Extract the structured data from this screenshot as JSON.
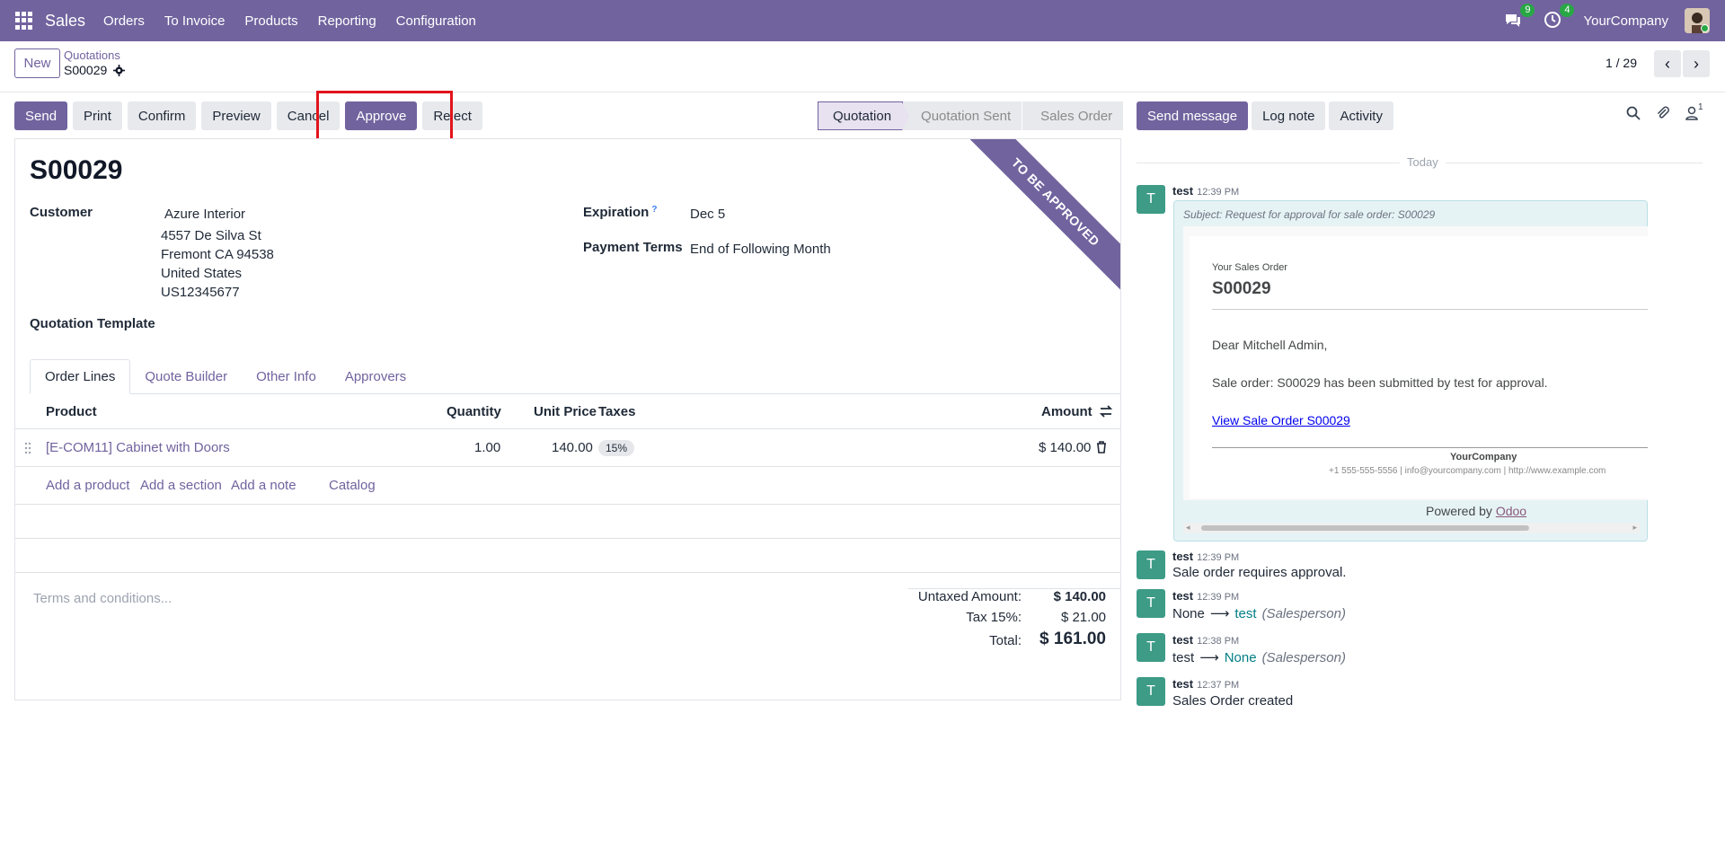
{
  "nav": {
    "app": "Sales",
    "items": [
      "Orders",
      "To Invoice",
      "Products",
      "Reporting",
      "Configuration"
    ],
    "messages_badge": "9",
    "activities_badge": "4",
    "company": "YourCompany"
  },
  "control": {
    "new_label": "New",
    "breadcrumb": "Quotations",
    "record": "S00029",
    "pager": "1 / 29"
  },
  "actions": [
    "Send",
    "Print",
    "Confirm",
    "Preview",
    "Cancel",
    "Approve",
    "Reject"
  ],
  "status": {
    "stages": [
      "Quotation",
      "Quotation Sent",
      "Sales Order"
    ],
    "active": "Quotation"
  },
  "form": {
    "ribbon": "TO BE APPROVED",
    "title": "S00029",
    "customer_label": "Customer",
    "customer_name": "Azure Interior",
    "address_lines": [
      "4557 De Silva St",
      "Fremont CA 94538",
      "United States",
      "US12345677"
    ],
    "template_label": "Quotation Template",
    "expiration_label": "Expiration",
    "expiration_help": "?",
    "expiration_value": "Dec 5",
    "payment_terms_label": "Payment Terms",
    "payment_terms_value": "End of Following Month",
    "tabs": [
      "Order Lines",
      "Quote Builder",
      "Other Info",
      "Approvers"
    ],
    "columns": [
      "Product",
      "Quantity",
      "Unit Price",
      "Taxes",
      "Amount"
    ],
    "lines": [
      {
        "product": "[E-COM11] Cabinet with Doors",
        "quantity": "1.00",
        "unit_price": "140.00",
        "tax": "15%",
        "amount": "$ 140.00"
      }
    ],
    "add_links": [
      "Add a product",
      "Add a section",
      "Add a note",
      "Catalog"
    ],
    "terms_placeholder": "Terms and conditions...",
    "untaxed_label": "Untaxed Amount:",
    "untaxed_value": "$ 140.00",
    "tax_label": "Tax 15%:",
    "tax_value": "$ 21.00",
    "total_label": "Total:",
    "total_value": "$ 161.00"
  },
  "chatter": {
    "buttons": [
      "Send message",
      "Log note",
      "Activity"
    ],
    "followers_count": "1",
    "today": "Today",
    "messages": [
      {
        "avatar": "T",
        "author": "test",
        "time": "12:39 PM",
        "subject": "Subject: Request for approval for sale order: S00029",
        "mail": {
          "caption": "Your Sales Order",
          "order": "S00029",
          "greeting": "Dear Mitchell Admin,",
          "body": "Sale order: S00029 has been submitted by test for approval.",
          "link": "View Sale Order S00029",
          "company": "YourCompany",
          "contact": "+1 555-555-5556 | info@yourcompany.com | http://www.example.com",
          "powered": "Powered by",
          "powered_brand": "Odoo"
        }
      },
      {
        "avatar": "T",
        "author": "test",
        "time": "12:39 PM",
        "body": "Sale order requires approval."
      },
      {
        "avatar": "T",
        "author": "test",
        "time": "12:39 PM",
        "old": "None",
        "arrow": "⟶",
        "new": "test",
        "field": "(Salesperson)"
      },
      {
        "avatar": "T",
        "author": "test",
        "time": "12:38 PM",
        "old": "test",
        "arrow": "⟶",
        "new": "None",
        "field": "(Salesperson)"
      },
      {
        "avatar": "T",
        "author": "test",
        "time": "12:37 PM",
        "body": "Sales Order created"
      }
    ]
  },
  "colors": {
    "brand": "#71639e",
    "avatar": "#3d9b86",
    "highlight": "#e2141b"
  }
}
